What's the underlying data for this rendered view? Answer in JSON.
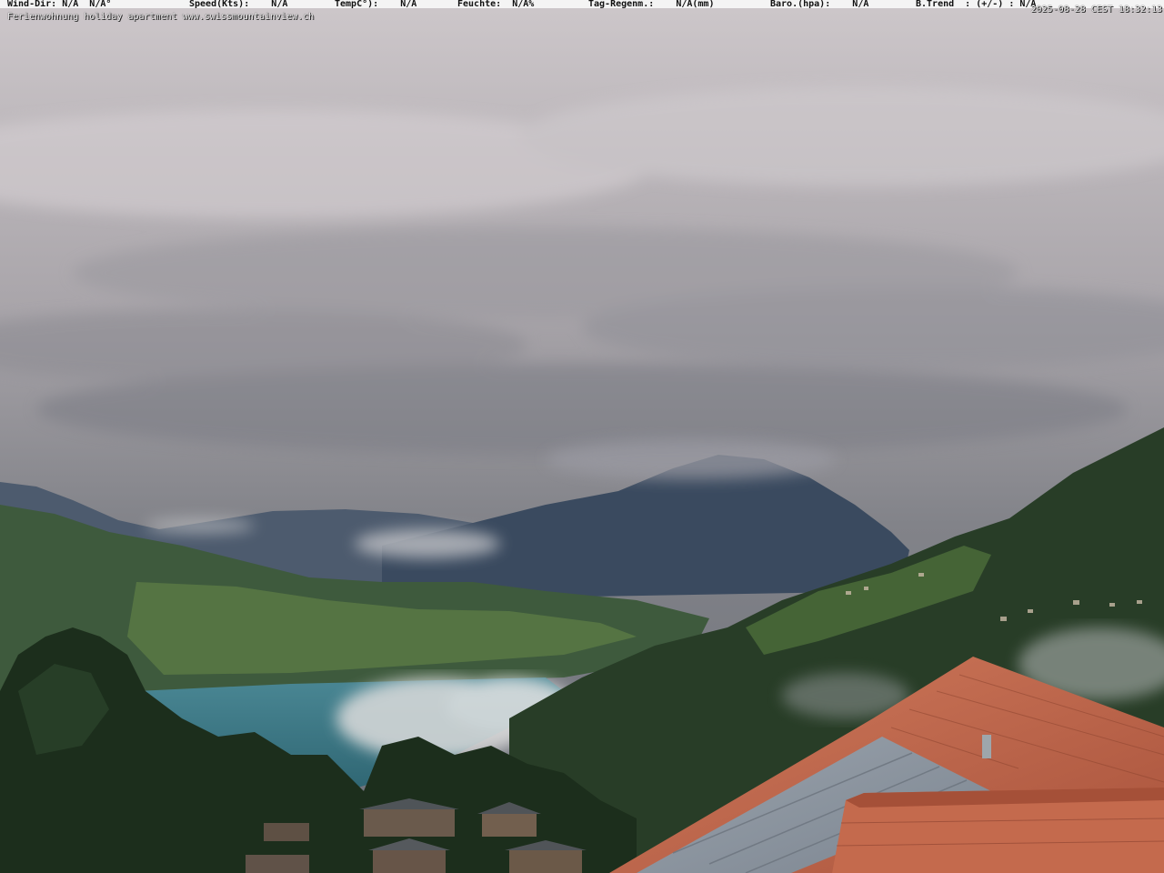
{
  "weather_bar": {
    "wind_dir": "Wind-Dir: N/A  N/A°",
    "speed": "Speed(Kts):    N/A",
    "temp": "TempC°):    N/A",
    "humidity": "Feuchte:  N/A%",
    "rain": "Tag-Regenm.:    N/A(mm)",
    "baro": "Baro.(hpa):    N/A",
    "trend": "B.Trend  : (+/-) : N/A"
  },
  "caption": "Ferienwohnung holiday apartment www.swissmountainview.ch",
  "timestamp": "2025-08-28 CEST 18:32:13",
  "colors": {
    "sky_top": "#c9c3c6",
    "sky_bottom": "#6e7179",
    "mountain": "#3b4a5e",
    "lake": "#3d7d8c",
    "roof": "#c2654a",
    "forest": "#1f3320"
  }
}
